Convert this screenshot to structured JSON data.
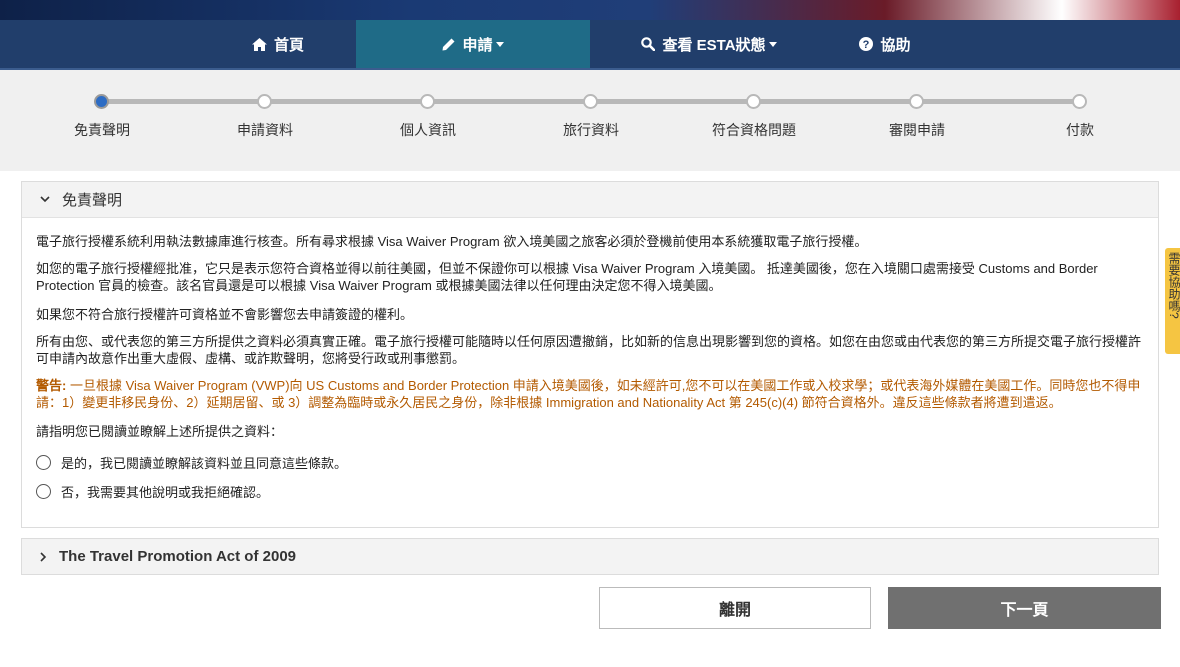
{
  "nav": {
    "items": [
      {
        "label": "首頁",
        "icon": "home-icon"
      },
      {
        "label": "申請",
        "icon": "pencil-icon",
        "dropdown": true,
        "active": true
      },
      {
        "label": "查看 ESTA狀態",
        "icon": "search-icon",
        "dropdown": true
      },
      {
        "label": "協助",
        "icon": "question-circle-icon"
      }
    ]
  },
  "progress": {
    "steps": [
      "免責聲明",
      "申請資料",
      "個人資訊",
      "旅行資料",
      "符合資格問題",
      "審閱申請",
      "付款"
    ],
    "current": 0
  },
  "disclaimer": {
    "title": "免責聲明",
    "paragraphs": [
      "電子旅行授權系統利用執法數據庫進行核查。所有尋求根據 Visa Waiver Program 欲入境美國之旅客必須於登機前使用本系統獲取電子旅行授權。",
      "如您的電子旅行授權經批准，它只是表示您符合資格並得以前往美國，但並不保證你可以根據 Visa Waiver Program 入境美國。 抵達美國後，您在入境關口處需接受 Customs and Border Protection 官員的檢查。該名官員還是可以根據 Visa Waiver Program 或根據美國法律以任何理由決定您不得入境美國。",
      "如果您不符合旅行授權許可資格並不會影響您去申請簽證的權利。",
      "所有由您、或代表您的第三方所提供之資料必須真實正確。電子旅行授權可能隨時以任何原因遭撤銷，比如新的信息出現影響到您的資格。如您在由您或由代表您的第三方所提交電子旅行授權許可申請內故意作出重大虛假、虛構、或詐欺聲明，您將受行政或刑事懲罰。"
    ],
    "warning_label": "警告:",
    "warning_text": " 一旦根據 Visa Waiver Program (VWP)向 US Customs and Border Protection 申請入境美國後，如未經許可,您不可以在美國工作或入校求學；或代表海外媒體在美國工作。同時您也不得申請：1）變更非移民身份、2）延期居留、或 3）調整為臨時或永久居民之身份，除非根據 Immigration and Nationality Act 第 245(c)(4) 節符合資格外。違反這些條款者將遭到遣返。",
    "confirm_prompt": "請指明您已閱讀並瞭解上述所提供之資料：",
    "options": [
      "是的，我已閱讀並瞭解該資料並且同意這些條款。",
      "否，我需要其他說明或我拒絕確認。"
    ]
  },
  "travel_promotion": {
    "title": "The Travel Promotion Act of 2009"
  },
  "buttons": {
    "leave": "離開",
    "next": "下一頁"
  },
  "feedback": {
    "label": "需要協助嗎?"
  },
  "colors": {
    "nav": "#213e6b",
    "nav_active": "#1f6b87",
    "warning": "#b35a00",
    "next_button": "#707070",
    "feedback_tab": "#f5c542"
  }
}
